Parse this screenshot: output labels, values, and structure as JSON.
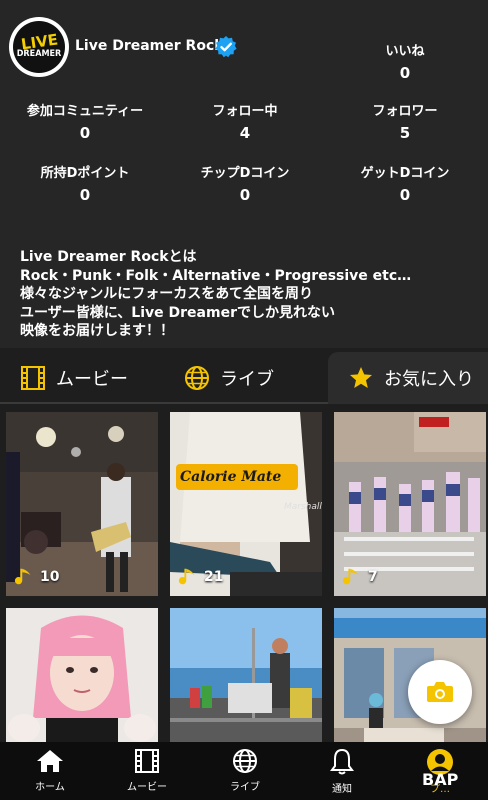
{
  "profile": {
    "logo_line1": "LIVE",
    "logo_line2": "DREAMER",
    "name": "Live Dreamer Rock"
  },
  "stats": {
    "likes": {
      "label": "いいね",
      "value": "0"
    },
    "communities": {
      "label": "参加コミュニティー",
      "value": "0"
    },
    "following": {
      "label": "フォロー中",
      "value": "4"
    },
    "followers": {
      "label": "フォロワー",
      "value": "5"
    },
    "points": {
      "label": "所持Dポイント",
      "value": "0"
    },
    "tip_coins": {
      "label": "チップDコイン",
      "value": "0"
    },
    "get_coins": {
      "label": "ゲットDコイン",
      "value": "0"
    }
  },
  "description": {
    "line1": "Live Dreamer Rockとは",
    "line2": "Rock・Punk・Folk・Alternative・Progressive etc…",
    "line3": "様々なジャンルにフォーカスをあて全国を周り",
    "line4": "ユーザー皆様に、Live Dreamerでしか見れない",
    "line5": "映像をお届けします！！"
  },
  "tabs": [
    {
      "label": "ムービー",
      "icon": "film-icon"
    },
    {
      "label": "ライブ",
      "icon": "globe-icon"
    },
    {
      "label": "お気に入り",
      "icon": "star-icon",
      "active": true
    }
  ],
  "tiles": [
    {
      "count": "10"
    },
    {
      "count": "21",
      "shirt_text": "Calorie Mate",
      "amp_text": "Marshall"
    },
    {
      "count": "7"
    },
    {
      "count": ""
    },
    {
      "count": ""
    },
    {
      "count": ""
    }
  ],
  "bottom_nav": [
    {
      "label": "ホーム",
      "icon": "home-icon"
    },
    {
      "label": "ムービー",
      "icon": "film-icon"
    },
    {
      "label": "ライブ",
      "icon": "globe-icon"
    },
    {
      "label": "通知",
      "icon": "bell-icon"
    },
    {
      "label": "プ…",
      "icon": "avatar-icon"
    }
  ],
  "watermark": "BAP",
  "colors": {
    "accent": "#f5c400",
    "verified": "#1da1f2",
    "background": "#262626"
  }
}
